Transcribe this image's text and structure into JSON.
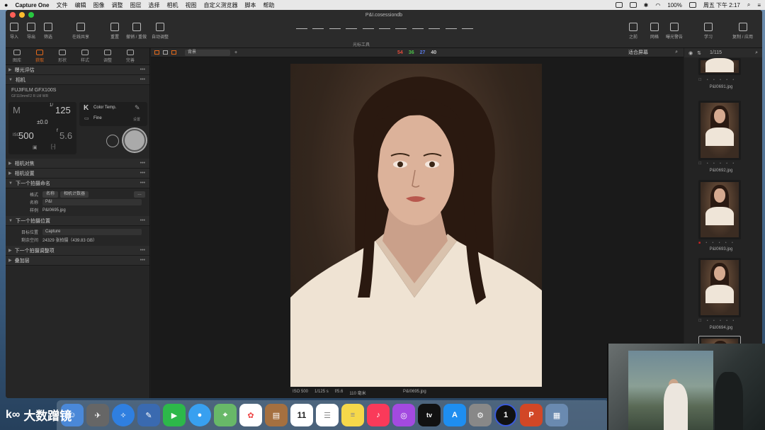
{
  "menubar": {
    "app_name": "Capture One",
    "items": [
      "文件",
      "编辑",
      "图像",
      "调整",
      "图层",
      "选择",
      "相机",
      "视图",
      "自定义测览器",
      "脚本",
      "帮助"
    ],
    "battery": "100%",
    "clock": "周五 下午 2:17"
  },
  "window": {
    "title": "P&I.cosessiondb"
  },
  "toolbar": {
    "left": [
      "导入",
      "导出",
      "筛选"
    ],
    "share": "在线共享",
    "history": [
      "重置",
      "撤销 / 重做",
      "自动调整"
    ],
    "cursor_tools_label": "光标工具",
    "right": [
      "之前",
      "网格",
      "曝光警告",
      "学习",
      "复制 / 应用"
    ]
  },
  "left_panel": {
    "tabs": [
      "图库",
      "获取",
      "形状",
      "样式",
      "调整",
      "完善"
    ],
    "sections": {
      "exposure_eval": "曝光评估",
      "camera": "相机",
      "camera_focus": "相机对焦",
      "camera_settings": "相机设置",
      "next_name": "下一个拍摄命名",
      "next_location": "下一个拍摄位置",
      "next_adjust": "下一个拍摄调整项",
      "overlay": "叠加层"
    },
    "camera": {
      "model": "FUJIFILM GFX100S",
      "lens": "GF110mmF2 R LM WR",
      "mode": "M",
      "shutter": "125",
      "shutter_prefix": "1/",
      "ev": "±0.0",
      "iso": "500",
      "iso_label": "ISO",
      "aperture": "5.6",
      "aperture_prefix": "f",
      "wb_letter": "K",
      "wb_label": "Color Temp.",
      "quality": "Fine",
      "settings_label": "设置"
    },
    "naming": {
      "format_label": "格式",
      "format_chips": [
        "名称",
        "相机计数器"
      ],
      "name_label": "名称",
      "name_value": "P&I",
      "sample_label": "样例",
      "sample_value": "P&I0695.jpg"
    },
    "location": {
      "target_label": "目标位置",
      "target_value": "Capture",
      "space_label": "剩余空间",
      "space_value": "24329 张拍摄（439.83 GB）"
    }
  },
  "viewer": {
    "layer_select": "背景",
    "counts": [
      {
        "value": "54",
        "color": "#e04a3a"
      },
      {
        "value": "36",
        "color": "#4cc04a"
      },
      {
        "value": "27",
        "color": "#5a7ae8"
      },
      {
        "value": "40",
        "color": "#cccccc"
      }
    ],
    "fit_label": "适合屏幕",
    "meta": [
      "ISO 500",
      "1/125 s",
      "f/5.6",
      "110 毫米"
    ],
    "filename": "P&I0695.jpg"
  },
  "right_panel": {
    "counter": "1/115",
    "thumbs": [
      {
        "name": "P&I0691.jpg"
      },
      {
        "name": "P&I0692.jpg"
      },
      {
        "name": "P&I0693.jpg"
      },
      {
        "name": "P&I0694.jpg"
      }
    ]
  },
  "dock": {
    "calendar_day": "11",
    "tv_label": "tv",
    "onepassword_label": "1",
    "powerpoint_label": "P"
  },
  "watermark": {
    "text": "大数蹭镜"
  },
  "colors": {
    "accent": "#e46a1c",
    "panel": "#262626"
  }
}
